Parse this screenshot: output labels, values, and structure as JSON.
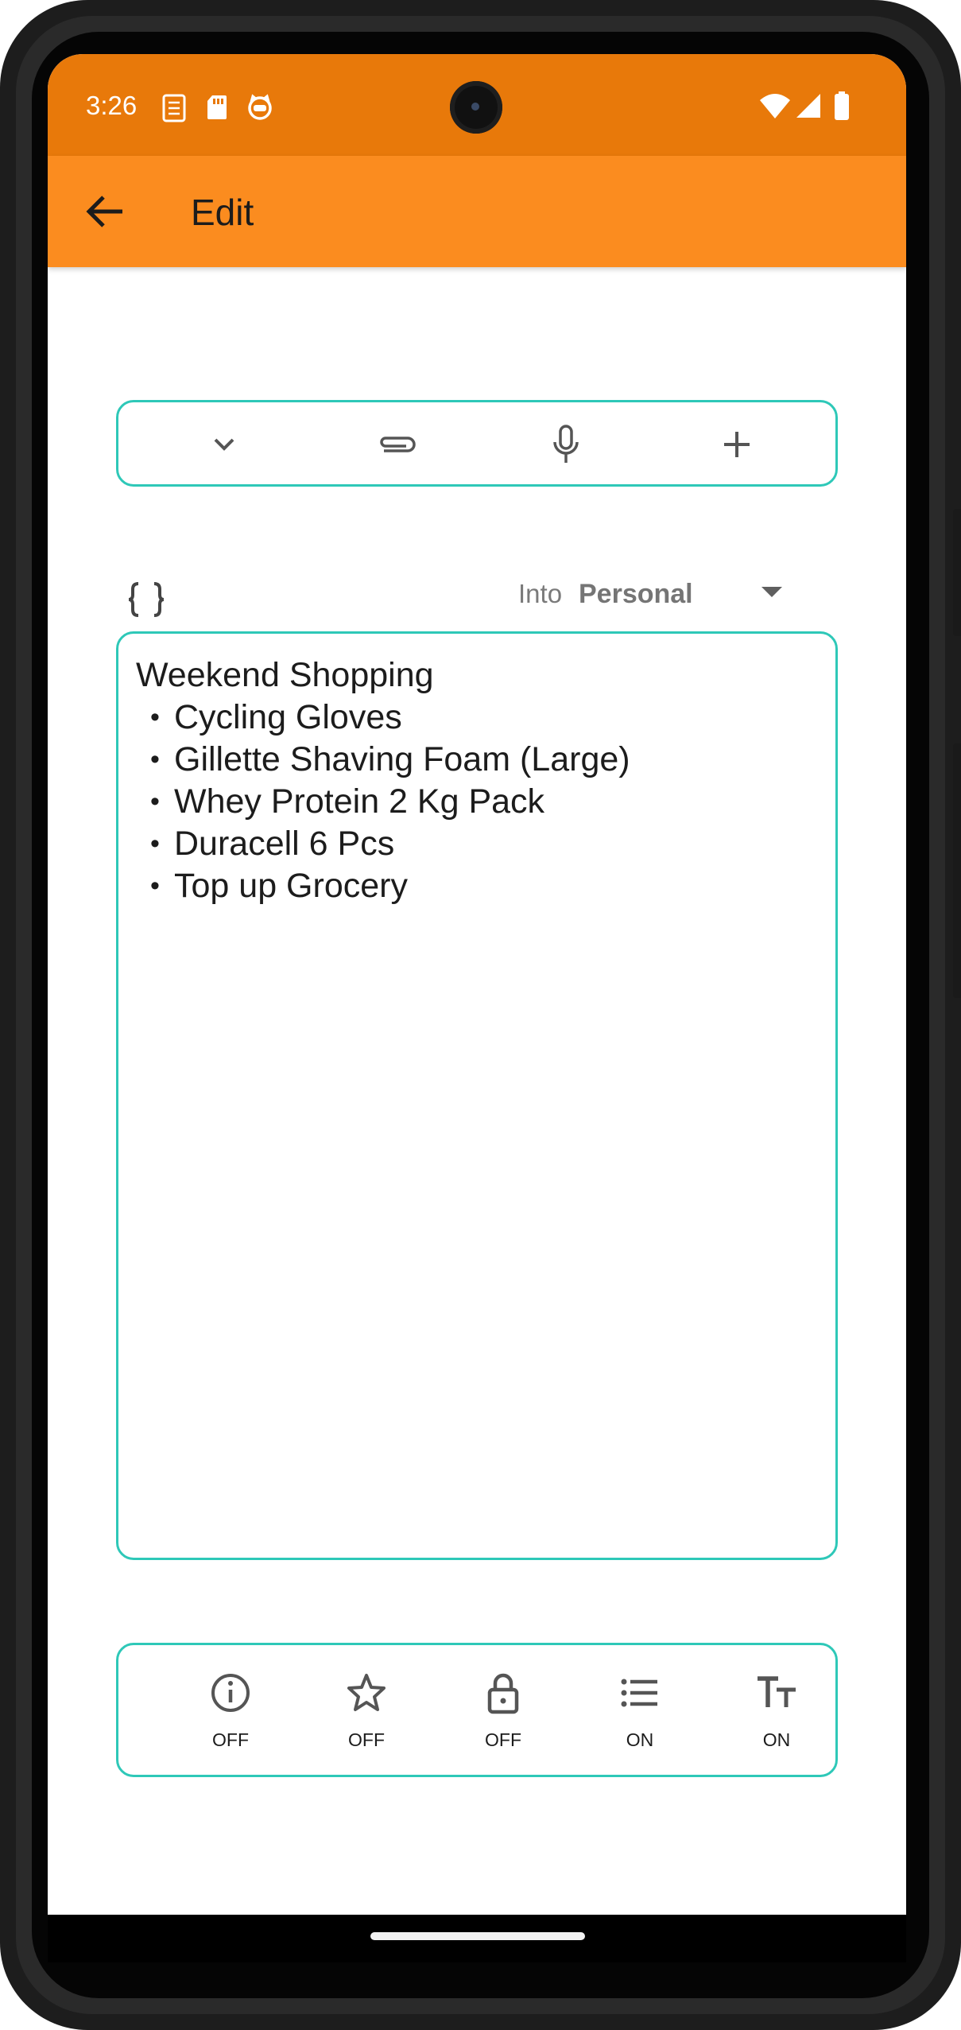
{
  "status_bar": {
    "time": "3:26",
    "left_icons": [
      "checklist-notification-icon",
      "sd-card-icon",
      "cat-face-icon"
    ],
    "right_icons": [
      "wifi-icon",
      "cell-signal-icon",
      "battery-icon"
    ]
  },
  "app_bar": {
    "title": "Edit",
    "back_icon": "arrow-back-icon"
  },
  "toolbar": {
    "buttons": [
      {
        "name": "collapse",
        "icon": "chevron-down-icon"
      },
      {
        "name": "attach",
        "icon": "paperclip-icon"
      },
      {
        "name": "voice",
        "icon": "microphone-icon"
      },
      {
        "name": "add",
        "icon": "plus-icon"
      }
    ]
  },
  "folder": {
    "label": "Into",
    "value": "Personal",
    "icon": "braces-icon"
  },
  "note": {
    "title": "Weekend Shopping",
    "items": [
      "Cycling Gloves",
      "Gillette Shaving Foam (Large)",
      "Whey Protein 2 Kg Pack",
      "Duracell 6 Pcs",
      "Top up Grocery"
    ],
    "bullet": "•"
  },
  "options": [
    {
      "icon": "info-icon",
      "state": "OFF"
    },
    {
      "icon": "star-icon",
      "state": "OFF"
    },
    {
      "icon": "lock-icon",
      "state": "OFF"
    },
    {
      "icon": "list-icon",
      "state": "ON"
    },
    {
      "icon": "text-size-icon",
      "state": "ON"
    }
  ],
  "colors": {
    "status_bar": "#e8790a",
    "app_bar": "#fb8c1f",
    "accent_outline": "#2ec8b8"
  }
}
